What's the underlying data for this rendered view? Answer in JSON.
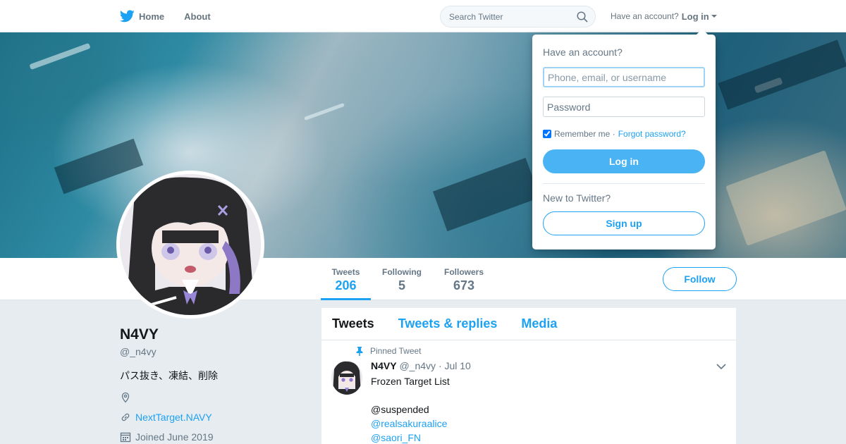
{
  "nav": {
    "home_label": "Home",
    "about_label": "About",
    "search_placeholder": "Search Twitter",
    "have_account": "Have an account?",
    "login_label": "Log in"
  },
  "profile": {
    "name": "N4VY",
    "handle": "@_n4vy",
    "bio": "パス抜き、凍結、削除",
    "website": "NextTarget.NAVY",
    "joined": "Joined June 2019"
  },
  "stats": [
    {
      "label": "Tweets",
      "value": "206"
    },
    {
      "label": "Following",
      "value": "5"
    },
    {
      "label": "Followers",
      "value": "673"
    }
  ],
  "follow_label": "Follow",
  "tabs": [
    "Tweets",
    "Tweets & replies",
    "Media"
  ],
  "tweet": {
    "pinned_label": "Pinned Tweet",
    "name": "N4VY",
    "handle": "@_n4vy",
    "date": "· Jul 10",
    "lines": [
      "Frozen Target List",
      "",
      "@suspended",
      "@realsakuraalice",
      "@saori_FN"
    ]
  },
  "login_dropdown": {
    "title": "Have an account?",
    "username_placeholder": "Phone, email, or username",
    "password_placeholder": "Password",
    "remember_label": "Remember me ·",
    "forgot_label": "Forgot password?",
    "login_button": "Log in",
    "new_question": "New to Twitter?",
    "signup_button": "Sign up"
  },
  "colors": {
    "accent": "#1da1f2",
    "login_button": "#4ab3f4",
    "page_background": "#e6ecf0"
  }
}
